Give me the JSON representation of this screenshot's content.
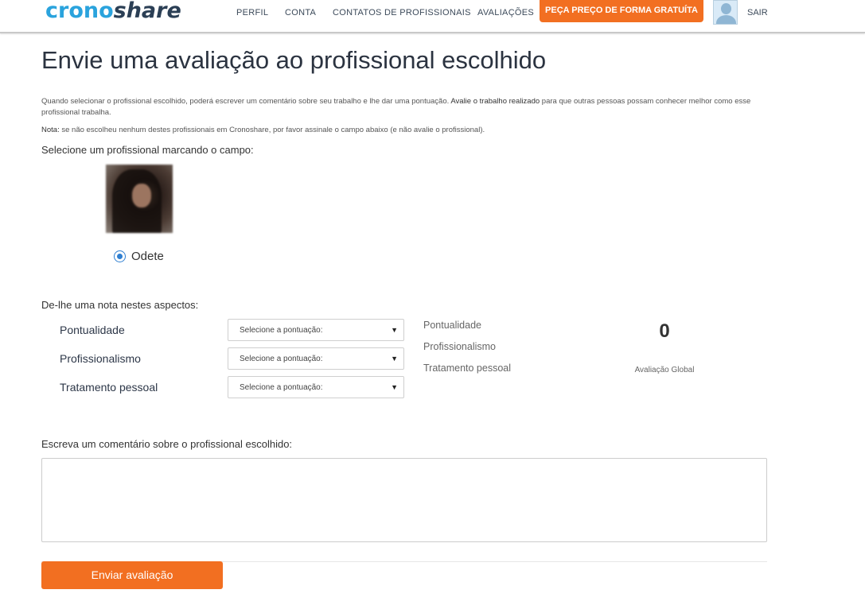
{
  "header": {
    "logo": {
      "part1": "crono",
      "part2": "share"
    },
    "nav": [
      "PERFIL",
      "CONTA",
      "CONTATOS DE PROFISSIONAIS",
      "AVALIAÇÕES"
    ],
    "cta_label": "PEÇA PREÇO DE FORMA GRATUÍTA",
    "logout_label": "SAIR"
  },
  "page": {
    "title": "Envie uma avaliação ao profissional escolhido",
    "intro_part1": "Quando selecionar o profissional escolhido, poderá escrever um comentário sobre seu trabalho e lhe dar uma pontuação. ",
    "intro_strong": "Avalie o trabalho realizado",
    "intro_part2": " para que outras pessoas possam conhecer melhor como esse profissional trabalha.",
    "note_label": "Nota:",
    "note_text": " se não escolheu nenhum destes profissionais em Cronoshare, por favor assinale o campo abaixo (e não avalie o profissional).",
    "select_prompt": "Selecione um profissional marcando o campo:"
  },
  "professional": {
    "name": "Odete",
    "selected": true
  },
  "rating": {
    "prompt": "De-lhe uma nota nestes aspectos:",
    "aspects": [
      "Pontualidade",
      "Profissionalismo",
      "Tratamento pessoal"
    ],
    "select_placeholder": "Selecione a pontuação:",
    "summary": [
      "Pontualidade",
      "Profissionalismo",
      "Tratamento pessoal"
    ],
    "global_score": "0",
    "global_label": "Avaliação Global"
  },
  "comment": {
    "label": "Escreva um comentário sobre o profissional escolhido:",
    "value": ""
  },
  "submit_label": "Enviar avaliação",
  "colors": {
    "accent": "#f26f21",
    "brand_blue": "#2aa3dd",
    "brand_dark": "#2b3f55",
    "radio": "#2f7fd1"
  }
}
